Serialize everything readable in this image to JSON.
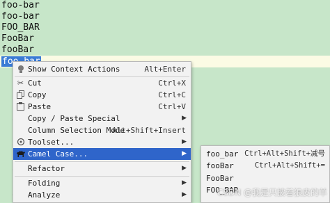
{
  "editor": {
    "lines": [
      "foo-bar",
      "foo-bar",
      "FOO_BAR",
      "FooBar",
      "fooBar",
      "foo_bar"
    ],
    "gutter_marks": [
      "-",
      "-",
      "-",
      "-"
    ]
  },
  "context_menu": {
    "items": [
      {
        "icon": "lightbulb-icon",
        "label": "Show Context Actions",
        "shortcut": "Alt+Enter"
      },
      {
        "icon": "scissors-icon",
        "label": "Cut",
        "shortcut": "Ctrl+X"
      },
      {
        "icon": "copy-icon",
        "label": "Copy",
        "shortcut": "Ctrl+C"
      },
      {
        "icon": "clipboard-icon",
        "label": "Paste",
        "shortcut": "Ctrl+V"
      },
      {
        "icon": "",
        "label": "Copy / Paste Special",
        "arrow": "▶"
      },
      {
        "icon": "",
        "label": "Column Selection Mode",
        "shortcut": "Alt+Shift+Insert"
      },
      {
        "icon": "toolset-icon",
        "label": "Toolset...",
        "arrow": "▶"
      },
      {
        "icon": "camel-icon",
        "label": "Camel Case...",
        "arrow": "▶"
      },
      {
        "icon": "",
        "label": "Refactor",
        "arrow": "▶"
      },
      {
        "icon": "",
        "label": "Folding",
        "arrow": "▶"
      },
      {
        "icon": "",
        "label": "Analyze",
        "arrow": "▶"
      }
    ]
  },
  "camel_submenu": {
    "items": [
      {
        "label": "foo_bar",
        "shortcut": "Ctrl+Alt+Shift+减号"
      },
      {
        "label": "fooBar",
        "shortcut": "Ctrl+Alt+Shift+="
      },
      {
        "label": "FooBar",
        "shortcut": ""
      },
      {
        "label": "FOO_BAR",
        "shortcut": ""
      }
    ]
  },
  "watermark": "CSDN @我是只披着狼皮的羊",
  "colors": {
    "editor_bg": "#c7e6c9",
    "menu_bg": "#f2f2f2",
    "active_item": "#2f65ca",
    "selection": "#3a7bd5"
  }
}
